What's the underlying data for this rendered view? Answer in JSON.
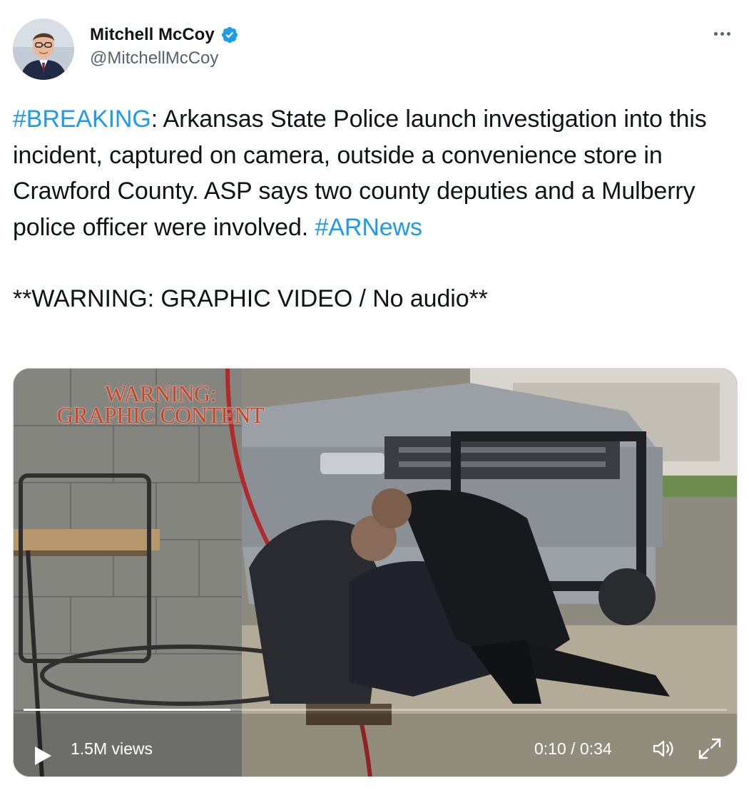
{
  "author": {
    "display_name": "Mitchell McCoy",
    "handle": "@MitchellMcCoy",
    "verified": true
  },
  "tweet": {
    "hashtag_breaking": "#BREAKING",
    "line_text": ": Arkansas State Police launch investigation into this incident, captured on camera, outside a convenience store in Crawford County. ASP says two county deputies and a Mulberry police officer were involved. ",
    "hashtag_arnews": "#ARNews",
    "warning": "**WARNING: GRAPHIC VIDEO / No audio**"
  },
  "video": {
    "overlay_line1": "WARNING:",
    "overlay_line2": "GRAPHIC CONTENT",
    "views": "1.5M views",
    "time": "0:10 / 0:34",
    "progress": 0.294
  },
  "icons": {
    "verified": "verified-badge-icon",
    "more": "more-options-icon",
    "play": "play-icon",
    "volume": "volume-icon",
    "fullscreen": "fullscreen-icon"
  },
  "colors": {
    "link": "#1d9bf0",
    "verified": "#1d9bf0",
    "warning_overlay": "#c84327",
    "secondary_text": "#536471"
  }
}
